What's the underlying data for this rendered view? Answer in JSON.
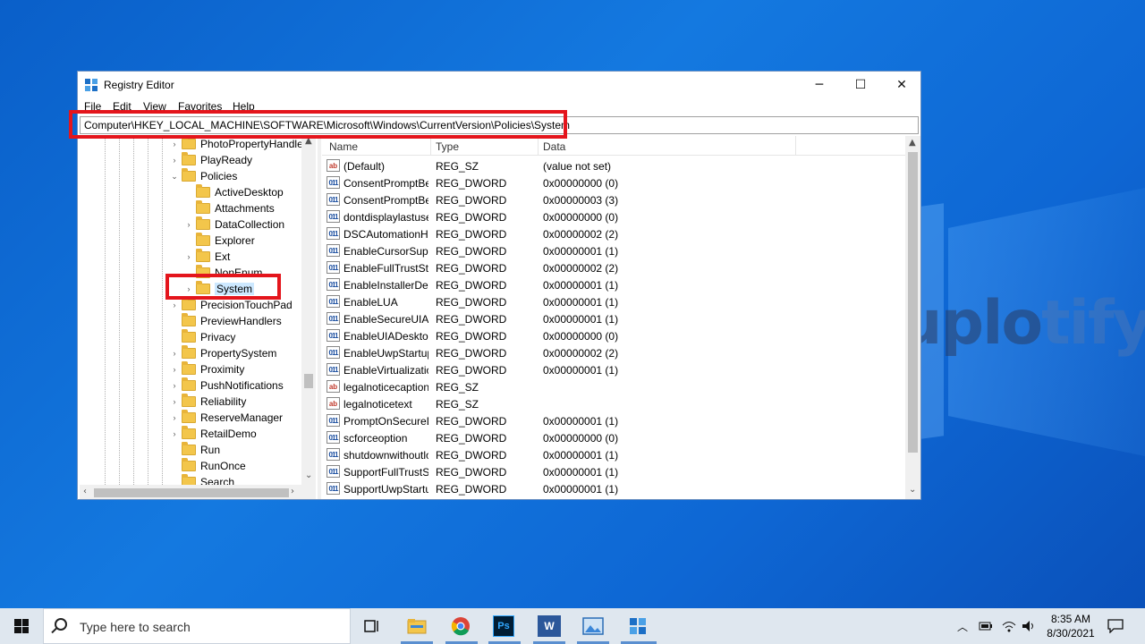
{
  "window": {
    "title": "Registry Editor",
    "minimize": "─",
    "maximize": "☐",
    "close": "✕"
  },
  "menu": [
    "File",
    "Edit",
    "View",
    "Favorites",
    "Help"
  ],
  "address": "Computer\\HKEY_LOCAL_MACHINE\\SOFTWARE\\Microsoft\\Windows\\CurrentVersion\\Policies\\System",
  "tree": [
    {
      "label": "PhotoPropertyHandler",
      "level": 1,
      "expander": "›"
    },
    {
      "label": "PlayReady",
      "level": 1,
      "expander": "›"
    },
    {
      "label": "Policies",
      "level": 1,
      "expander": "⌄"
    },
    {
      "label": "ActiveDesktop",
      "level": 2,
      "expander": ""
    },
    {
      "label": "Attachments",
      "level": 2,
      "expander": ""
    },
    {
      "label": "DataCollection",
      "level": 2,
      "expander": "›"
    },
    {
      "label": "Explorer",
      "level": 2,
      "expander": ""
    },
    {
      "label": "Ext",
      "level": 2,
      "expander": "›"
    },
    {
      "label": "NonEnum",
      "level": 2,
      "expander": ""
    },
    {
      "label": "System",
      "level": 2,
      "expander": "›",
      "selected": true
    },
    {
      "label": "PrecisionTouchPad",
      "level": 1,
      "expander": "›"
    },
    {
      "label": "PreviewHandlers",
      "level": 1,
      "expander": ""
    },
    {
      "label": "Privacy",
      "level": 1,
      "expander": ""
    },
    {
      "label": "PropertySystem",
      "level": 1,
      "expander": "›"
    },
    {
      "label": "Proximity",
      "level": 1,
      "expander": "›"
    },
    {
      "label": "PushNotifications",
      "level": 1,
      "expander": "›"
    },
    {
      "label": "Reliability",
      "level": 1,
      "expander": "›"
    },
    {
      "label": "ReserveManager",
      "level": 1,
      "expander": "›"
    },
    {
      "label": "RetailDemo",
      "level": 1,
      "expander": "›"
    },
    {
      "label": "Run",
      "level": 1,
      "expander": ""
    },
    {
      "label": "RunOnce",
      "level": 1,
      "expander": ""
    },
    {
      "label": "Search",
      "level": 1,
      "expander": ""
    }
  ],
  "columns": {
    "name": "Name",
    "type": "Type",
    "data": "Data"
  },
  "values": [
    {
      "icon": "ab",
      "name": "(Default)",
      "type": "REG_SZ",
      "data": "(value not set)"
    },
    {
      "icon": "011",
      "name": "ConsentPromptBehaviorAdmin",
      "type": "REG_DWORD",
      "data": "0x00000000 (0)"
    },
    {
      "icon": "011",
      "name": "ConsentPromptBehaviorUser",
      "type": "REG_DWORD",
      "data": "0x00000003 (3)"
    },
    {
      "icon": "011",
      "name": "dontdisplaylastusername",
      "type": "REG_DWORD",
      "data": "0x00000000 (0)"
    },
    {
      "icon": "011",
      "name": "DSCAutomationHostEnabled",
      "type": "REG_DWORD",
      "data": "0x00000002 (2)"
    },
    {
      "icon": "011",
      "name": "EnableCursorSuppression",
      "type": "REG_DWORD",
      "data": "0x00000001 (1)"
    },
    {
      "icon": "011",
      "name": "EnableFullTrustStartupTasks",
      "type": "REG_DWORD",
      "data": "0x00000002 (2)"
    },
    {
      "icon": "011",
      "name": "EnableInstallerDetection",
      "type": "REG_DWORD",
      "data": "0x00000001 (1)"
    },
    {
      "icon": "011",
      "name": "EnableLUA",
      "type": "REG_DWORD",
      "data": "0x00000001 (1)"
    },
    {
      "icon": "011",
      "name": "EnableSecureUIAPaths",
      "type": "REG_DWORD",
      "data": "0x00000001 (1)"
    },
    {
      "icon": "011",
      "name": "EnableUIADesktopToggle",
      "type": "REG_DWORD",
      "data": "0x00000000 (0)"
    },
    {
      "icon": "011",
      "name": "EnableUwpStartupTasks",
      "type": "REG_DWORD",
      "data": "0x00000002 (2)"
    },
    {
      "icon": "011",
      "name": "EnableVirtualization",
      "type": "REG_DWORD",
      "data": "0x00000001 (1)"
    },
    {
      "icon": "ab",
      "name": "legalnoticecaption",
      "type": "REG_SZ",
      "data": ""
    },
    {
      "icon": "ab",
      "name": "legalnoticetext",
      "type": "REG_SZ",
      "data": ""
    },
    {
      "icon": "011",
      "name": "PromptOnSecureDesktop",
      "type": "REG_DWORD",
      "data": "0x00000001 (1)"
    },
    {
      "icon": "011",
      "name": "scforceoption",
      "type": "REG_DWORD",
      "data": "0x00000000 (0)"
    },
    {
      "icon": "011",
      "name": "shutdownwithoutlogon",
      "type": "REG_DWORD",
      "data": "0x00000001 (1)"
    },
    {
      "icon": "011",
      "name": "SupportFullTrustStartupTasks",
      "type": "REG_DWORD",
      "data": "0x00000001 (1)"
    },
    {
      "icon": "011",
      "name": "SupportUwpStartupTasks",
      "type": "REG_DWORD",
      "data": "0x00000001 (1)"
    }
  ],
  "watermark": {
    "main": "uplo",
    "fade": "tify"
  },
  "taskbar": {
    "search_placeholder": "Type here to search",
    "time": "8:35 AM",
    "date": "8/30/2021"
  },
  "colors": {
    "highlight": "#e4151c",
    "selection": "#cce8ff",
    "desktop": "#0e6fd8"
  }
}
